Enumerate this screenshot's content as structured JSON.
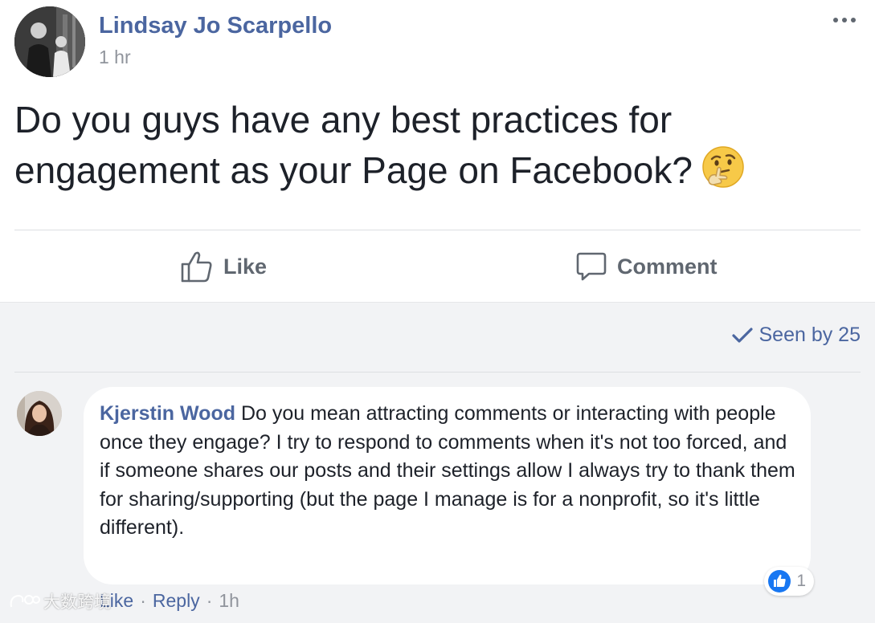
{
  "post": {
    "author": "Lindsay Jo Scarpello",
    "time": "1 hr",
    "text": "Do you guys have any best practices for engagement as your Page on Facebook?",
    "emoji": "thinking-face-icon"
  },
  "actions": {
    "like_label": "Like",
    "comment_label": "Comment"
  },
  "seen": {
    "label": "Seen by 25"
  },
  "comment": {
    "author": "Kjerstin Wood",
    "text": "Do you mean attracting comments or interacting with people once they engage? I try to respond to comments when it's not too forced, and if someone shares our posts and their settings allow I always try to thank them for sharing/supporting (but the page I manage is for a nonprofit, so it's little different).",
    "reaction_count": "1",
    "like_label": "Like",
    "reply_label": "Reply",
    "time": "1h"
  },
  "watermark": {
    "text": "大数跨境"
  },
  "colors": {
    "brand_blue": "#4b66a0",
    "like_blue": "#1877f2",
    "comment_bg": "#f2f3f5",
    "meta_gray": "#90949c"
  }
}
